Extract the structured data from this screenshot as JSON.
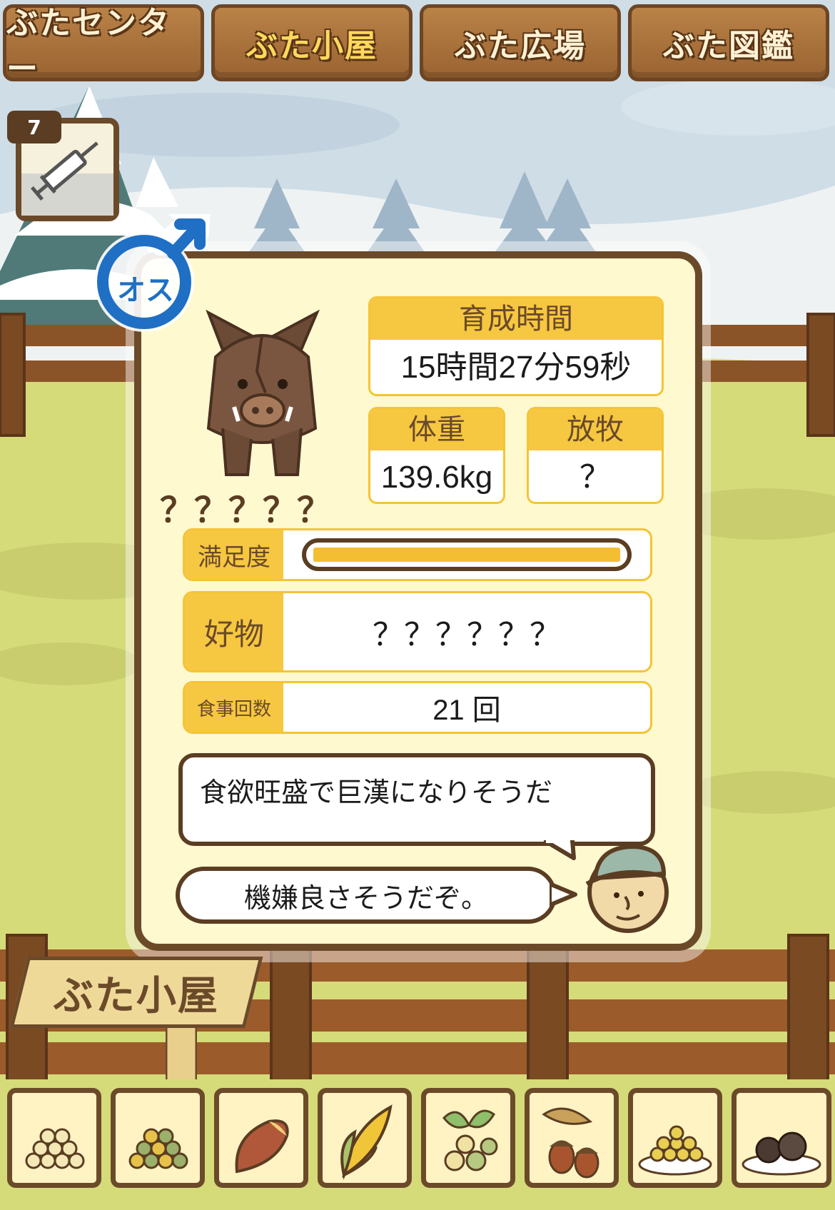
{
  "tabs": [
    {
      "label": "ぶたセンター",
      "active": false
    },
    {
      "label": "ぶた小屋",
      "active": true
    },
    {
      "label": "ぶた広場",
      "active": false
    },
    {
      "label": "ぶた図鑑",
      "active": false
    }
  ],
  "item": {
    "count": "7",
    "icon": "syringe-icon"
  },
  "pig": {
    "gender_label": "オス",
    "gender_icon": "male-symbol-icon",
    "name": "？？？？？",
    "stats": {
      "growth_time_label": "育成時間",
      "growth_time_value": "15時間27分59秒",
      "weight_label": "体重",
      "weight_value": "139.6kg",
      "grazing_label": "放牧",
      "grazing_value": "？"
    },
    "satisfaction_label": "満足度",
    "satisfaction_level": 1.0,
    "favorite_label": "好物",
    "favorite_value": "？？？？？？",
    "meals_label": "食事回数",
    "meals_value": "21 回",
    "comment": "食欲旺盛で巨漢になりそうだ",
    "mood": "機嫌良さそうだぞ。"
  },
  "signboard": "ぶた小屋",
  "foods": [
    "soybean-pile-icon",
    "mixed-bean-pile-icon",
    "sweet-potato-icon",
    "corn-icon",
    "herb-berries-icon",
    "acorn-icon",
    "bean-plate-icon",
    "truffle-plate-icon"
  ],
  "colors": {
    "accent": "#f6c740",
    "frame": "#6b4a2a",
    "panel": "#fff9d0",
    "male_blue": "#1f6fc4"
  }
}
